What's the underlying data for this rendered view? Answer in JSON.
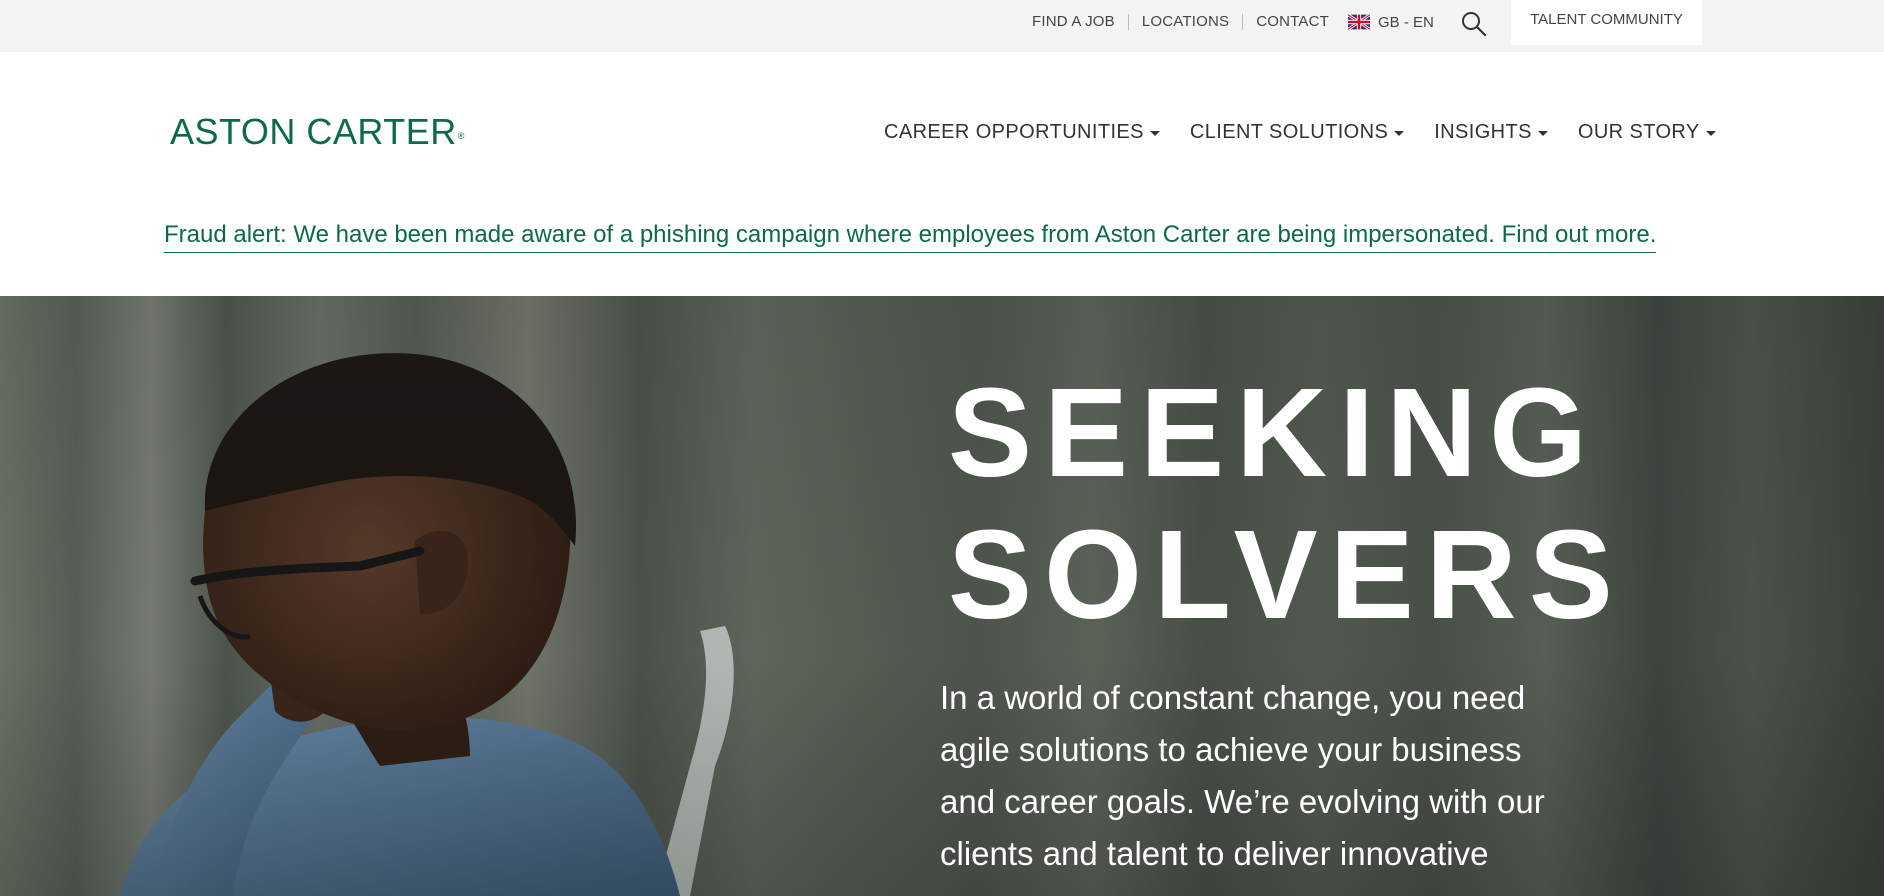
{
  "utility_bar": {
    "links": [
      {
        "label": "FIND A JOB"
      },
      {
        "label": "LOCATIONS"
      },
      {
        "label": "CONTACT"
      }
    ],
    "language": "GB - EN",
    "talent_community": "TALENT COMMUNITY"
  },
  "header": {
    "logo_text": "ASTON CARTER",
    "logo_mark": "®",
    "nav": [
      {
        "label": "CAREER OPPORTUNITIES"
      },
      {
        "label": "CLIENT SOLUTIONS"
      },
      {
        "label": "INSIGHTS"
      },
      {
        "label": "OUR STORY"
      }
    ]
  },
  "fraud_alert": {
    "text": "Fraud alert: We have been made aware of a phishing campaign where employees from Aston Carter are being impersonated. Find out more."
  },
  "hero": {
    "title_line1": "SEEKING",
    "title_line2": "SOLVERS",
    "body": "In a world of constant change, you need agile solutions to achieve your business and career goals. We’re evolving with our clients and talent to deliver innovative"
  },
  "colors": {
    "brand_green": "#0b6a4a",
    "utility_bg": "#f4f4f4"
  },
  "icons": [
    "search-icon",
    "uk-flag-icon",
    "chevron-down-icon"
  ]
}
